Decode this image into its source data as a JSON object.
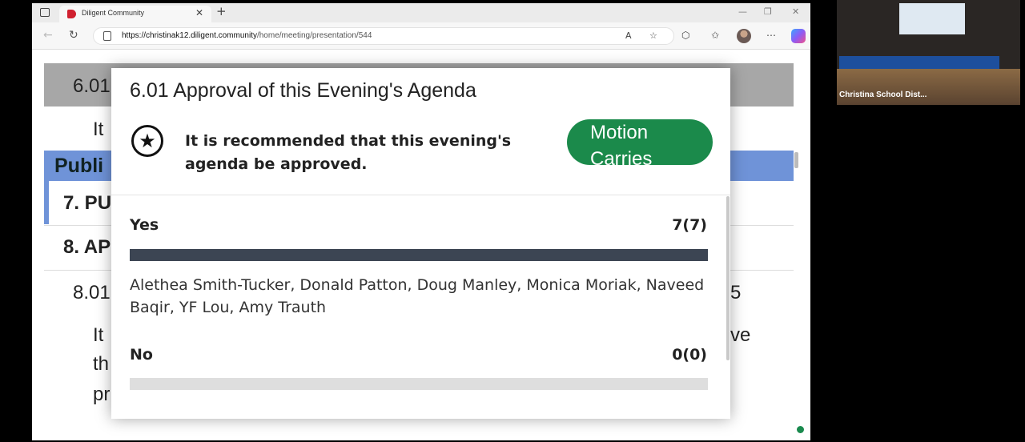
{
  "browser": {
    "tab_title": "Diligent Community",
    "url_host": "https://christinak12.diligent.community",
    "url_path": "/home/meeting/presentation/544"
  },
  "background_page": {
    "item_6_01": "6.01",
    "it_line": "It",
    "public_heading": "Publi",
    "item_7": "7. PU",
    "item_8": "8. AP",
    "item_8_01": "8.01",
    "item_8_01_right": "5",
    "para_it": "It",
    "para_th": "th",
    "para_pr": "pr",
    "para_right": "ve"
  },
  "modal": {
    "title": "6.01 Approval of this Evening's Agenda",
    "recommendation": "It is recommended that this evening's agenda be approved.",
    "status_line1": "Motion",
    "status_line2": "Carries",
    "status_color": "#1b8a4b",
    "yes_label": "Yes",
    "yes_count": "7(7)",
    "yes_fraction": 1.0,
    "yes_names": "Alethea Smith-Tucker, Donald Patton, Doug Manley, Monica Moriak, Naveed Baqir, YF Lou, Amy Trauth",
    "no_label": "No",
    "no_count": "0(0)",
    "no_fraction": 0.0
  },
  "video_feed": {
    "label": "Christina School Dist..."
  }
}
